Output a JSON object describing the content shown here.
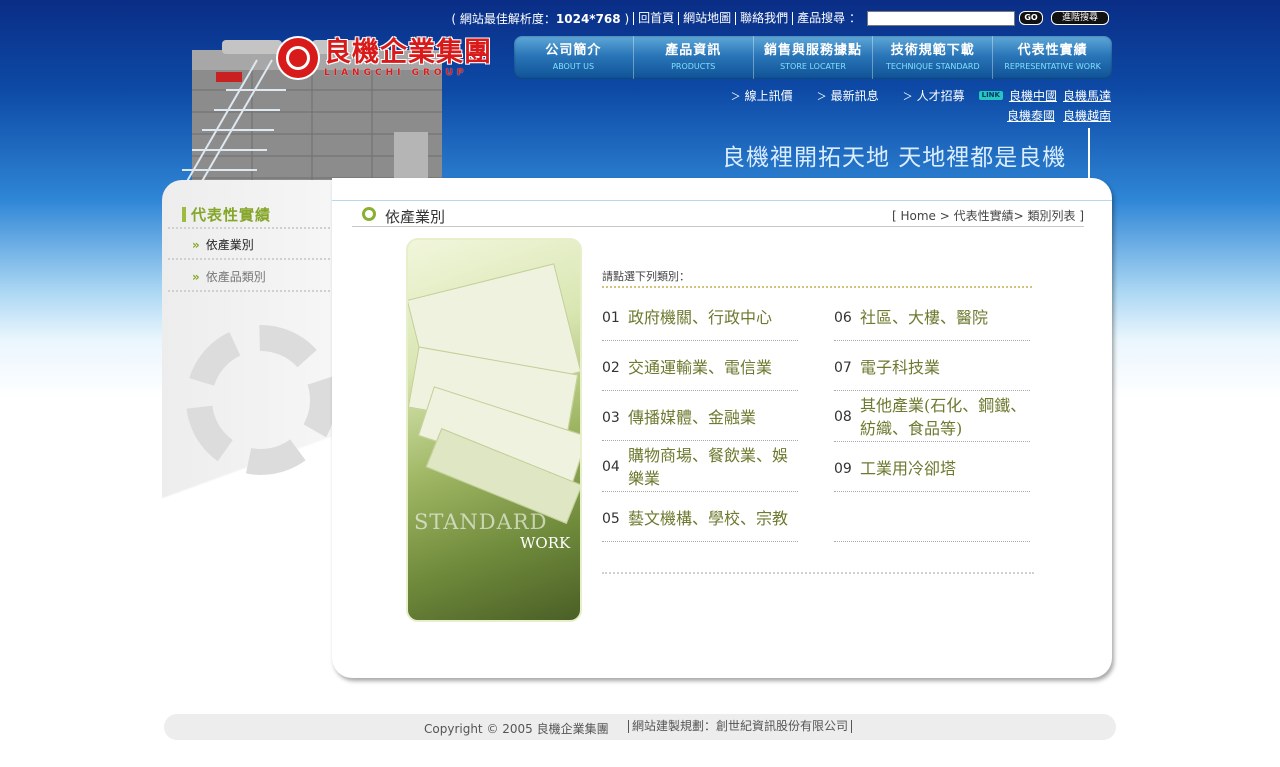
{
  "util": {
    "resolution_prefix": "( 網站最佳解析度：",
    "resolution_value": "1024*768",
    "resolution_suffix": " )",
    "links": [
      "回首頁",
      "網站地圖",
      "聯絡我們"
    ],
    "search_label": "產品搜尋 ：",
    "search_value": "",
    "go_label": "GO",
    "advanced_label": "進階搜尋"
  },
  "logo": {
    "cn": "良機企業集團",
    "en": "LIANGCHI GROUP"
  },
  "nav": [
    {
      "zh": "公司簡介",
      "en": "ABOUT US"
    },
    {
      "zh": "產品資訊",
      "en": "PRODUCTS"
    },
    {
      "zh": "銷售與服務據點",
      "en": "STORE LOCATER"
    },
    {
      "zh": "技術規範下載",
      "en": "TECHNIQUE STANDARD"
    },
    {
      "zh": "代表性實績",
      "en": "REPRESENTATIVE WORK"
    }
  ],
  "sublinks": [
    "線上訊價",
    "最新訊息",
    "人才招募"
  ],
  "link_badge": "LINK",
  "related": [
    "良機中國",
    "良機馬達",
    "良機泰國",
    "良機越南"
  ],
  "slogan": "良機裡開拓天地  天地裡都是良機",
  "sidebar": {
    "title": "代表性實績",
    "items": [
      {
        "label": "依產業別",
        "active": true
      },
      {
        "label": "依產品類別",
        "active": false
      }
    ]
  },
  "page": {
    "title": "依產業別",
    "breadcrumb": [
      "[ Home",
      " > ",
      "代表性實績",
      "> ",
      "類別列表 ]"
    ]
  },
  "photo": {
    "line1": "STANDARD",
    "line2": "WORK"
  },
  "intro": "請點選下列類別：",
  "categories": [
    {
      "num": "01",
      "label": "政府機關、行政中心"
    },
    {
      "num": "02",
      "label": "交通運輸業、電信業"
    },
    {
      "num": "03",
      "label": "傳播媒體、金融業"
    },
    {
      "num": "04",
      "label": "購物商場、餐飲業、娛樂業"
    },
    {
      "num": "05",
      "label": "藝文機構、學校、宗教"
    },
    {
      "num": "06",
      "label": "社區、大樓、醫院"
    },
    {
      "num": "07",
      "label": "電子科技業"
    },
    {
      "num": "08",
      "label": "其他產業(石化、鋼鐵、紡織、食品等)"
    },
    {
      "num": "09",
      "label": "工業用冷卻塔"
    }
  ],
  "footer": {
    "copyright": "Copyright © 2005    良機企業集團",
    "builder": "網站建製規劃：創世紀資訊股份有限公司"
  }
}
